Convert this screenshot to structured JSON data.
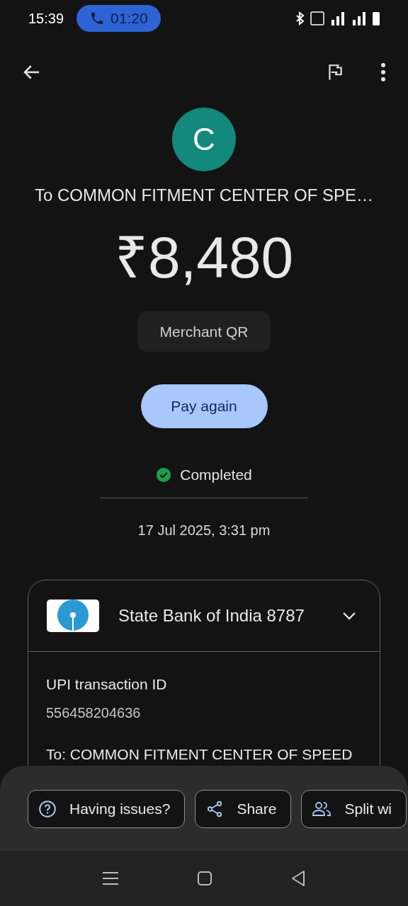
{
  "status_bar": {
    "time": "15:39",
    "call_timer": "01:20"
  },
  "payee": {
    "initial": "C",
    "title": "To COMMON FITMENT CENTER OF SPE…"
  },
  "amount": "₹8,480",
  "payment_type": "Merchant QR",
  "pay_again_button": "Pay again",
  "status": {
    "label": "Completed",
    "kind": "success"
  },
  "date": "17 Jul 2025, 3:31 pm",
  "account_card": {
    "bank": "State Bank of India 8787",
    "expanded": false,
    "details": [
      {
        "label": "UPI transaction ID",
        "value": "556458204636"
      },
      {
        "label": "To: COMMON FITMENT CENTER OF SPEED"
      }
    ]
  },
  "actions": [
    {
      "label": "Having issues?",
      "kind": "help"
    },
    {
      "label": "Share",
      "kind": "share"
    },
    {
      "label": "Split wi",
      "kind": "split"
    }
  ]
}
